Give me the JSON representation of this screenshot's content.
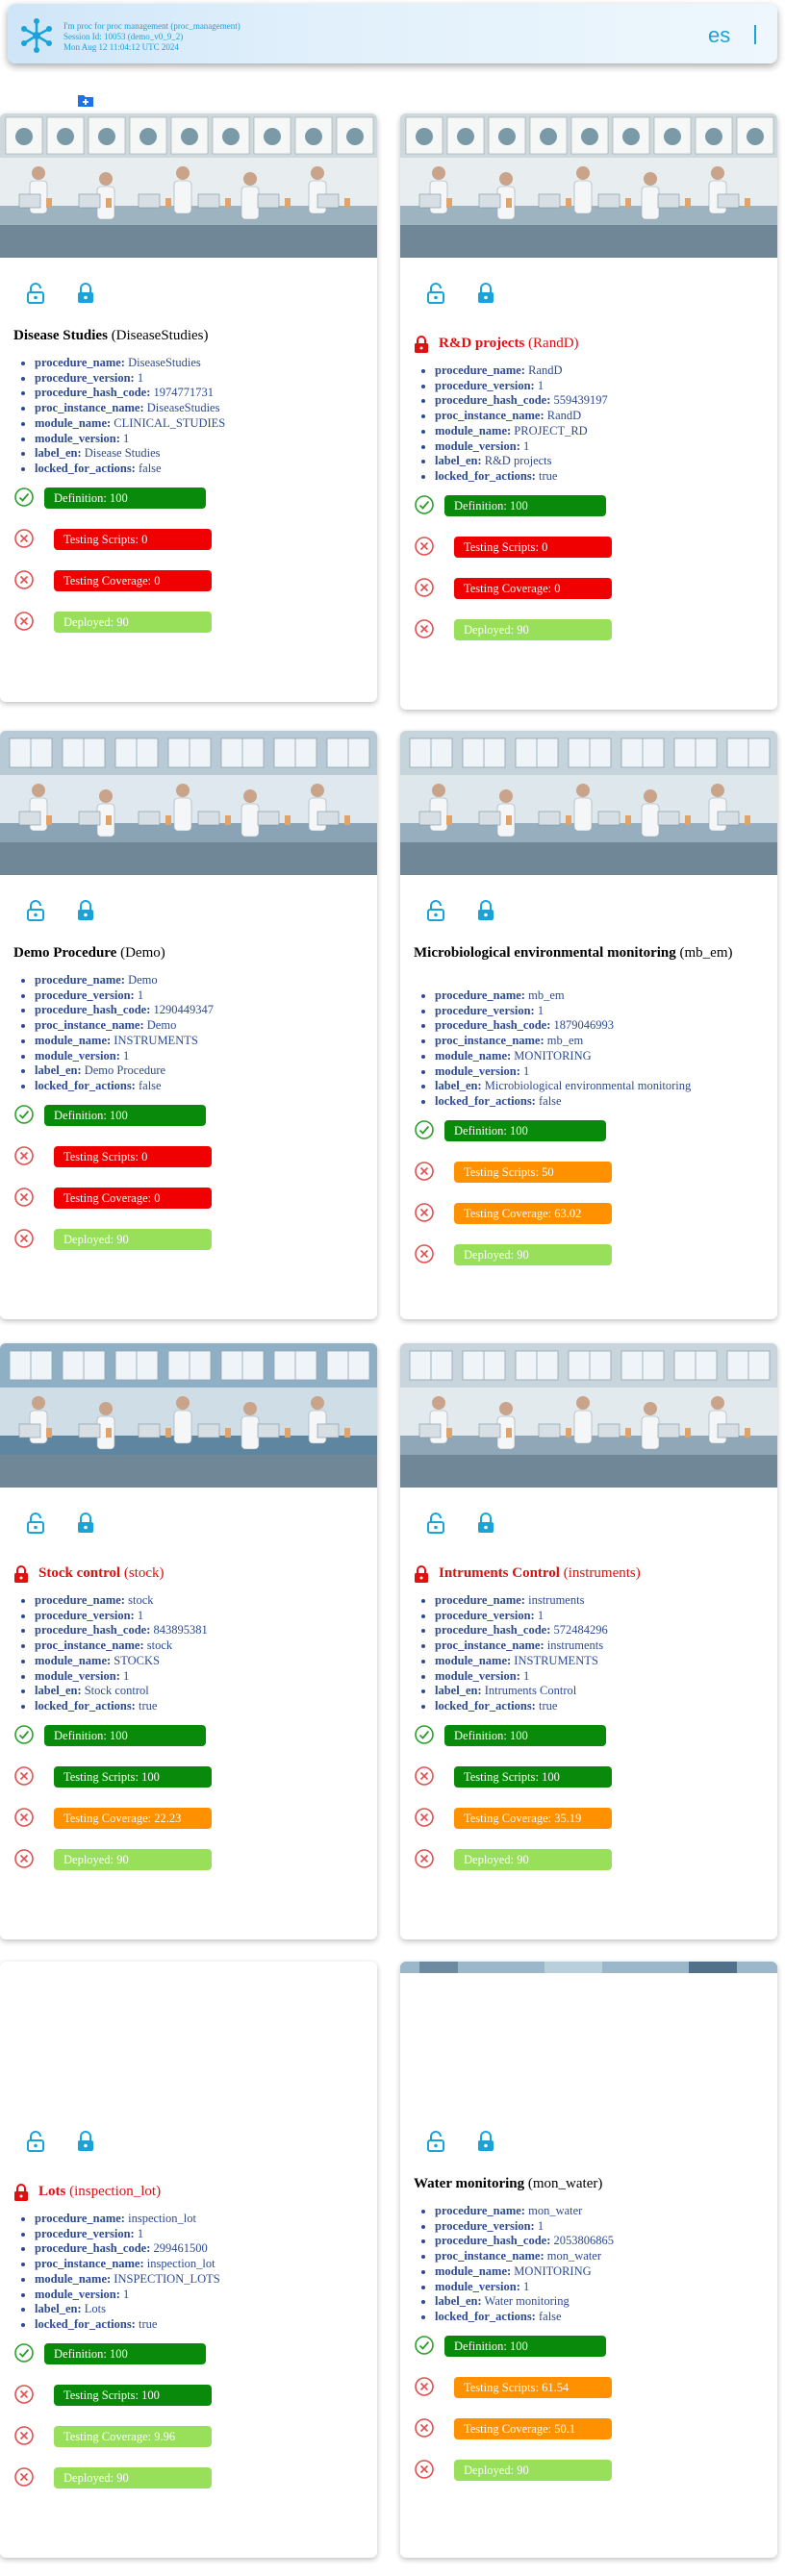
{
  "header": {
    "session_line1": "I'm proc for proc management (proc_management)",
    "session_line2": "Session Id: 10053 (demo_v0_9_2)",
    "session_line3": "Mon Aug 12 11:04:12 UTC 2024",
    "lang_button": "es",
    "accent_color": "#1aa3d9"
  },
  "cards": [
    {
      "title": "Disease Studies",
      "code": "(DiseaseStudies)",
      "locked": false,
      "props": [
        {
          "key": "procedure_name:",
          "val": "DiseaseStudies"
        },
        {
          "key": "procedure_version:",
          "val": "1"
        },
        {
          "key": "procedure_hash_code:",
          "val": "1974771731"
        },
        {
          "key": "proc_instance_name:",
          "val": "DiseaseStudies"
        },
        {
          "key": "module_name:",
          "val": "CLINICAL_STUDIES"
        },
        {
          "key": "module_version:",
          "val": "1"
        },
        {
          "key": "label_en:",
          "val": "Disease Studies"
        },
        {
          "key": "locked_for_actions:",
          "val": "false"
        }
      ],
      "stages": [
        {
          "label": "Definition: 100",
          "color": "green",
          "status": "check-icon"
        },
        {
          "label": "Testing Scripts: 0",
          "color": "red",
          "status": "x-icon"
        },
        {
          "label": "Testing Coverage: 0",
          "color": "red",
          "status": "x-icon"
        },
        {
          "label": "Deployed: 90",
          "color": "lime",
          "status": "x-icon"
        }
      ]
    },
    {
      "title": "R&D projects",
      "code": "(RandD)",
      "locked": true,
      "props": [
        {
          "key": "procedure_name:",
          "val": "RandD"
        },
        {
          "key": "procedure_version:",
          "val": "1"
        },
        {
          "key": "procedure_hash_code:",
          "val": "559439197"
        },
        {
          "key": "proc_instance_name:",
          "val": "RandD"
        },
        {
          "key": "module_name:",
          "val": "PROJECT_RD"
        },
        {
          "key": "module_version:",
          "val": "1"
        },
        {
          "key": "label_en:",
          "val": "R&D projects"
        },
        {
          "key": "locked_for_actions:",
          "val": "true"
        }
      ],
      "stages": [
        {
          "label": "Definition: 100",
          "color": "green",
          "status": "check-icon"
        },
        {
          "label": "Testing Scripts: 0",
          "color": "red",
          "status": "x-icon"
        },
        {
          "label": "Testing Coverage: 0",
          "color": "red",
          "status": "x-icon"
        },
        {
          "label": "Deployed: 90",
          "color": "lime",
          "status": "x-icon"
        }
      ]
    },
    {
      "title": "Demo Procedure",
      "code": "(Demo)",
      "locked": false,
      "props": [
        {
          "key": "procedure_name:",
          "val": "Demo"
        },
        {
          "key": "procedure_version:",
          "val": "1"
        },
        {
          "key": "procedure_hash_code:",
          "val": "1290449347"
        },
        {
          "key": "proc_instance_name:",
          "val": "Demo"
        },
        {
          "key": "module_name:",
          "val": "INSTRUMENTS"
        },
        {
          "key": "module_version:",
          "val": "1"
        },
        {
          "key": "label_en:",
          "val": "Demo Procedure"
        },
        {
          "key": "locked_for_actions:",
          "val": "false"
        }
      ],
      "stages": [
        {
          "label": "Definition: 100",
          "color": "green",
          "status": "check-icon"
        },
        {
          "label": "Testing Scripts: 0",
          "color": "red",
          "status": "x-icon"
        },
        {
          "label": "Testing Coverage: 0",
          "color": "red",
          "status": "x-icon"
        },
        {
          "label": "Deployed: 90",
          "color": "lime",
          "status": "x-icon"
        }
      ]
    },
    {
      "title": "Microbiological environmental monitoring",
      "code": "(mb_em)",
      "locked": false,
      "props": [
        {
          "key": "procedure_name:",
          "val": "mb_em"
        },
        {
          "key": "procedure_version:",
          "val": "1"
        },
        {
          "key": "procedure_hash_code:",
          "val": "1879046993"
        },
        {
          "key": "proc_instance_name:",
          "val": "mb_em"
        },
        {
          "key": "module_name:",
          "val": "MONITORING"
        },
        {
          "key": "module_version:",
          "val": "1"
        },
        {
          "key": "label_en:",
          "val": "Microbiological environmental monitoring"
        },
        {
          "key": "locked_for_actions:",
          "val": "false"
        }
      ],
      "stages": [
        {
          "label": "Definition: 100",
          "color": "green",
          "status": "check-icon"
        },
        {
          "label": "Testing Scripts: 50",
          "color": "orange",
          "status": "x-icon"
        },
        {
          "label": "Testing Coverage: 63.02",
          "color": "orange",
          "status": "x-icon"
        },
        {
          "label": "Deployed: 90",
          "color": "lime",
          "status": "x-icon"
        }
      ]
    },
    {
      "title": "Stock control",
      "code": "(stock)",
      "locked": true,
      "props": [
        {
          "key": "procedure_name:",
          "val": "stock"
        },
        {
          "key": "procedure_version:",
          "val": "1"
        },
        {
          "key": "procedure_hash_code:",
          "val": "843895381"
        },
        {
          "key": "proc_instance_name:",
          "val": "stock"
        },
        {
          "key": "module_name:",
          "val": "STOCKS"
        },
        {
          "key": "module_version:",
          "val": "1"
        },
        {
          "key": "label_en:",
          "val": "Stock control"
        },
        {
          "key": "locked_for_actions:",
          "val": "true"
        }
      ],
      "stages": [
        {
          "label": "Definition: 100",
          "color": "green",
          "status": "check-icon"
        },
        {
          "label": "Testing Scripts: 100",
          "color": "green",
          "status": "x-icon"
        },
        {
          "label": "Testing Coverage: 22.23",
          "color": "orange",
          "status": "x-icon"
        },
        {
          "label": "Deployed: 90",
          "color": "lime",
          "status": "x-icon"
        }
      ]
    },
    {
      "title": "Intruments Control",
      "code": "(instruments)",
      "locked": true,
      "props": [
        {
          "key": "procedure_name:",
          "val": "instruments"
        },
        {
          "key": "procedure_version:",
          "val": "1"
        },
        {
          "key": "procedure_hash_code:",
          "val": "572484296"
        },
        {
          "key": "proc_instance_name:",
          "val": "instruments"
        },
        {
          "key": "module_name:",
          "val": "INSTRUMENTS"
        },
        {
          "key": "module_version:",
          "val": "1"
        },
        {
          "key": "label_en:",
          "val": "Intruments Control"
        },
        {
          "key": "locked_for_actions:",
          "val": "true"
        }
      ],
      "stages": [
        {
          "label": "Definition: 100",
          "color": "green",
          "status": "check-icon"
        },
        {
          "label": "Testing Scripts: 100",
          "color": "green",
          "status": "x-icon"
        },
        {
          "label": "Testing Coverage: 35.19",
          "color": "orange",
          "status": "x-icon"
        },
        {
          "label": "Deployed: 90",
          "color": "lime",
          "status": "x-icon"
        }
      ]
    },
    {
      "title": "Lots",
      "code": "(inspection_lot)",
      "locked": true,
      "props": [
        {
          "key": "procedure_name:",
          "val": "inspection_lot"
        },
        {
          "key": "procedure_version:",
          "val": "1"
        },
        {
          "key": "procedure_hash_code:",
          "val": "299461500"
        },
        {
          "key": "proc_instance_name:",
          "val": "inspection_lot"
        },
        {
          "key": "module_name:",
          "val": "INSPECTION_LOTS"
        },
        {
          "key": "module_version:",
          "val": "1"
        },
        {
          "key": "label_en:",
          "val": "Lots"
        },
        {
          "key": "locked_for_actions:",
          "val": "true"
        }
      ],
      "stages": [
        {
          "label": "Definition: 100",
          "color": "green",
          "status": "check-icon"
        },
        {
          "label": "Testing Scripts: 100",
          "color": "green",
          "status": "x-icon"
        },
        {
          "label": "Testing Coverage: 9.96",
          "color": "lime",
          "status": "x-icon"
        },
        {
          "label": "Deployed: 90",
          "color": "lime",
          "status": "x-icon"
        }
      ]
    },
    {
      "title": "Water monitoring",
      "code": "(mon_water)",
      "locked": false,
      "props": [
        {
          "key": "procedure_name:",
          "val": "mon_water"
        },
        {
          "key": "procedure_version:",
          "val": "1"
        },
        {
          "key": "procedure_hash_code:",
          "val": "2053806865"
        },
        {
          "key": "proc_instance_name:",
          "val": "mon_water"
        },
        {
          "key": "module_name:",
          "val": "MONITORING"
        },
        {
          "key": "module_version:",
          "val": "1"
        },
        {
          "key": "label_en:",
          "val": "Water monitoring"
        },
        {
          "key": "locked_for_actions:",
          "val": "false"
        }
      ],
      "stages": [
        {
          "label": "Definition: 100",
          "color": "green",
          "status": "check-icon"
        },
        {
          "label": "Testing Scripts: 61.54",
          "color": "orange",
          "status": "x-icon"
        },
        {
          "label": "Testing Coverage: 50.1",
          "color": "orange",
          "status": "x-icon"
        },
        {
          "label": "Deployed: 90",
          "color": "lime",
          "status": "x-icon"
        }
      ]
    }
  ]
}
